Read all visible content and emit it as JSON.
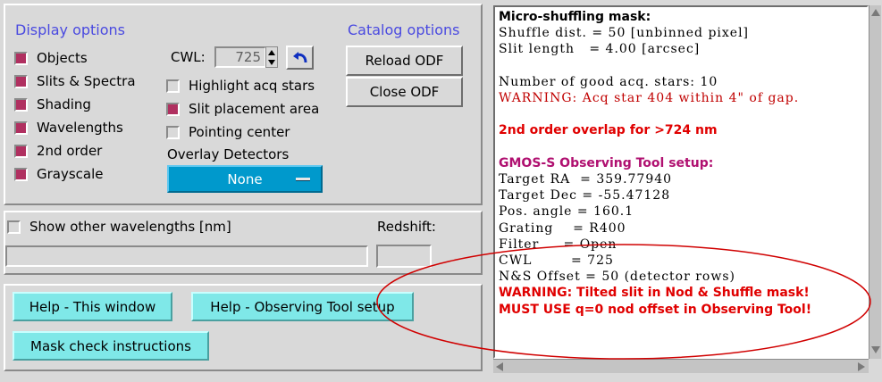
{
  "display_options": {
    "heading": "Display options",
    "items": [
      {
        "label": "Objects",
        "checked": true
      },
      {
        "label": "Slits & Spectra",
        "checked": true
      },
      {
        "label": "Shading",
        "checked": true
      },
      {
        "label": "Wavelengths",
        "checked": true
      },
      {
        "label": "2nd order",
        "checked": true
      },
      {
        "label": "Grayscale",
        "checked": true
      }
    ]
  },
  "cwl": {
    "label": "CWL:",
    "value": "725"
  },
  "toggles": [
    {
      "label": "Highlight acq stars",
      "checked": false
    },
    {
      "label": "Slit placement area",
      "checked": true
    },
    {
      "label": "Pointing center",
      "checked": false
    }
  ],
  "overlay": {
    "label": "Overlay Detectors",
    "value": "None"
  },
  "catalog": {
    "heading": "Catalog options",
    "reload": "Reload ODF",
    "close": "Close ODF"
  },
  "wavelengths": {
    "show_label": "Show other wavelengths [nm]",
    "redshift_label": "Redshift:",
    "list_value": "",
    "redshift_value": ""
  },
  "help": {
    "window": "Help - This window",
    "ot_setup": "Help - Observing Tool setup",
    "mask_check": "Mask check instructions"
  },
  "output": {
    "lines": [
      {
        "text": "Micro-shuffling mask:",
        "style": "bold",
        "color": "#000000"
      },
      {
        "text": "Shuffle dist. = 50 [unbinned pixel]",
        "style": "mono",
        "color": "#000000"
      },
      {
        "text": "Slit length   = 4.00 [arcsec]",
        "style": "mono",
        "color": "#000000"
      },
      {
        "text": "",
        "style": "mono",
        "color": "#000000"
      },
      {
        "text": "Number of good acq. stars: 10",
        "style": "mono",
        "color": "#000000"
      },
      {
        "text": "WARNING: Acq star 404 within 4\" of gap.",
        "style": "mono",
        "color": "#c00000"
      },
      {
        "text": "",
        "style": "mono",
        "color": "#000000"
      },
      {
        "text": "2nd order overlap for >724 nm",
        "style": "bold",
        "color": "#e00000"
      },
      {
        "text": "",
        "style": "mono",
        "color": "#000000"
      },
      {
        "text": "GMOS-S Observing Tool setup:",
        "style": "bold",
        "color": "#b01070"
      },
      {
        "text": "Target RA  = 359.77940",
        "style": "mono",
        "color": "#000000"
      },
      {
        "text": "Target Dec = -55.47128",
        "style": "mono",
        "color": "#000000"
      },
      {
        "text": "Pos. angle = 160.1",
        "style": "mono",
        "color": "#000000"
      },
      {
        "text": "Grating    = R400",
        "style": "mono",
        "color": "#000000"
      },
      {
        "text": "Filter     = Open",
        "style": "mono",
        "color": "#000000"
      },
      {
        "text": "CWL        = 725",
        "style": "mono",
        "color": "#000000"
      },
      {
        "text": "N&S Offset = 50 (detector rows)",
        "style": "mono",
        "color": "#000000"
      },
      {
        "text": "WARNING: Tilted slit in Nod & Shuffle mask!",
        "style": "bold",
        "color": "#e00000"
      },
      {
        "text": "MUST USE q=0 nod offset in Observing Tool!",
        "style": "bold",
        "color": "#e00000"
      }
    ]
  },
  "colors": {
    "checkbox_on": "#b03060",
    "accent_blue": "#0099cc",
    "help_button": "#7fe8e8",
    "annotation_ellipse": "#d00000"
  }
}
